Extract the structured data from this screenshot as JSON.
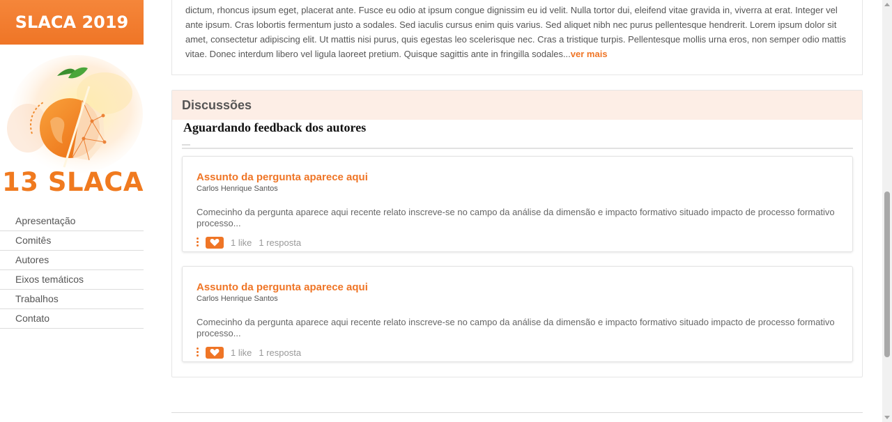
{
  "sidebar": {
    "brand": "SLACA 2019",
    "logo_text": "13 SLACA",
    "nav": [
      {
        "label": "Apresentação"
      },
      {
        "label": "Comitês"
      },
      {
        "label": "Autores"
      },
      {
        "label": "Eixos temáticos"
      },
      {
        "label": "Trabalhos"
      },
      {
        "label": "Contato"
      }
    ]
  },
  "description": {
    "text": "dictum, rhoncus ipsum eget, placerat ante. Fusce eu odio at ipsum congue dignissim eu id velit. Nulla tortor dui, eleifend vitae gravida in, viverra at erat. Integer vel ante ipsum. Cras lobortis fermentum justo a sodales. Sed iaculis cursus enim quis varius. Sed aliquet nibh nec purus pellentesque hendrerit. Lorem ipsum dolor sit amet, consectetur adipiscing elit. Ut mattis nisi purus, quis egestas leo scelerisque nec. Cras a tristique turpis. Pellentesque mollis urna eros, non semper odio mattis vitae. Donec interdum libero vel ligula laoreet pretium. Quisque sagittis ante in fringilla sodales...",
    "more_link": "ver mais"
  },
  "discussions": {
    "title": "Discussões",
    "status": "Aguardando feedback dos autores",
    "questions": [
      {
        "title": "Assunto da pergunta aparece aqui",
        "author": "Carlos Henrique Santos",
        "excerpt": "Comecinho da pergunta aparece aqui recente relato inscreve-se no campo da análise da dimensão e impacto formativo situado impacto de processo formativo processo...",
        "likes": "1 like",
        "replies": "1 resposta"
      },
      {
        "title": "Assunto da pergunta aparece aqui",
        "author": "Carlos Henrique Santos",
        "excerpt": "Comecinho da pergunta aparece aqui recente relato inscreve-se no campo da análise da dimensão e impacto formativo situado impacto de processo formativo processo...",
        "likes": "1 like",
        "replies": "1 resposta"
      }
    ]
  },
  "colors": {
    "accent": "#ef7526",
    "header_bg": "#fdeee6"
  }
}
